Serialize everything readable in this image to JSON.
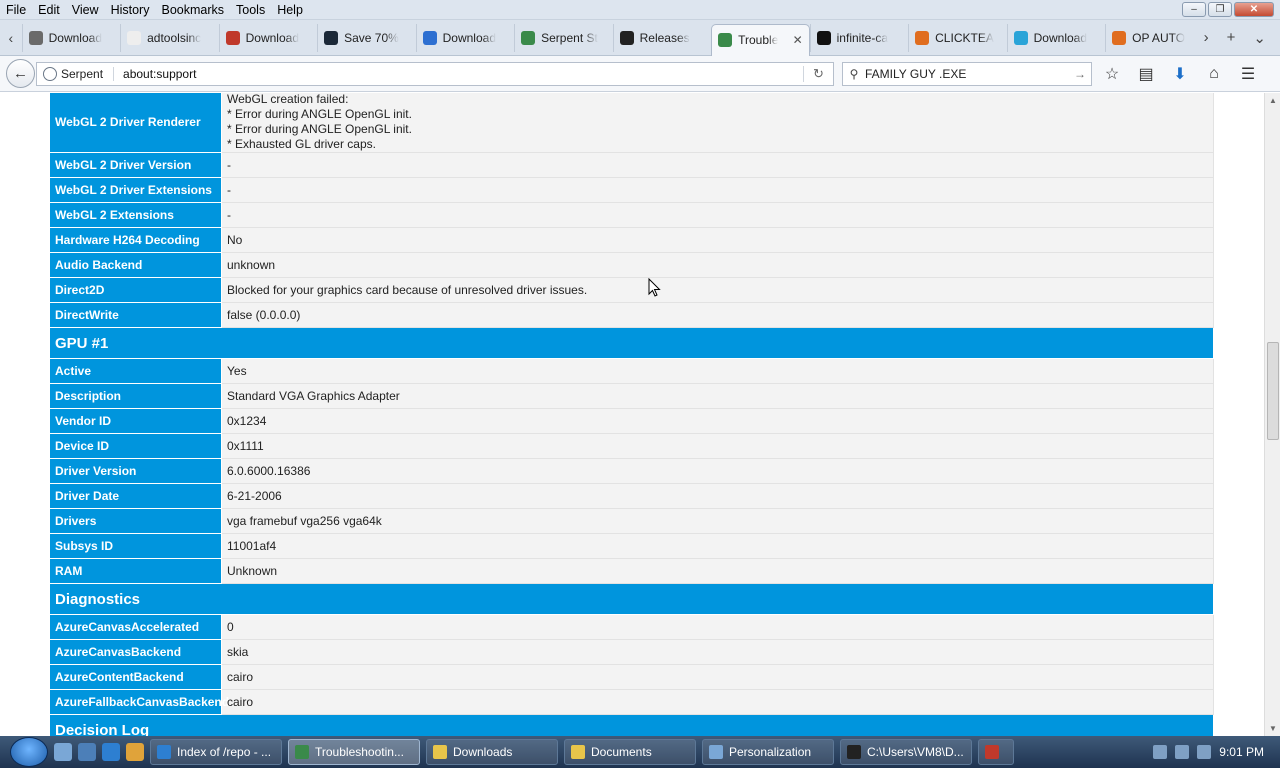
{
  "menu": [
    "File",
    "Edit",
    "View",
    "History",
    "Bookmarks",
    "Tools",
    "Help"
  ],
  "tabs": [
    {
      "label": "Download",
      "color": "#6a6a6a"
    },
    {
      "label": "adtoolsinc",
      "color": "#eeeeee"
    },
    {
      "label": "Download",
      "color": "#c0392b"
    },
    {
      "label": "Save 70%",
      "color": "#1b2838"
    },
    {
      "label": "Download",
      "color": "#2d6fd1"
    },
    {
      "label": "Serpent St",
      "color": "#3a8a4a"
    },
    {
      "label": "Releases",
      "color": "#222222"
    },
    {
      "label": "Trouble",
      "color": "#3a8a4a",
      "active": true
    },
    {
      "label": "infinite-ca",
      "color": "#111111"
    },
    {
      "label": "CLICKTEA",
      "color": "#e06d1f"
    },
    {
      "label": "Download",
      "color": "#2aa4d8"
    },
    {
      "label": "OP AUTO",
      "color": "#e06d1f"
    }
  ],
  "nav": {
    "brand": "Serpent",
    "url": "about:support",
    "search": "FAMILY GUY .EXE"
  },
  "rows": [
    {
      "type": "row",
      "key": "WebGL 2 Driver Renderer",
      "lines": [
        "WebGL creation failed:",
        "* Error during ANGLE OpenGL init.",
        "* Error during ANGLE OpenGL init.",
        "* Exhausted GL driver caps."
      ]
    },
    {
      "type": "row",
      "key": "WebGL 2 Driver Version",
      "value": "-"
    },
    {
      "type": "row",
      "key": "WebGL 2 Driver Extensions",
      "value": "-"
    },
    {
      "type": "row",
      "key": "WebGL 2 Extensions",
      "value": "-"
    },
    {
      "type": "row",
      "key": "Hardware H264 Decoding",
      "value": "No"
    },
    {
      "type": "row",
      "key": "Audio Backend",
      "value": "unknown"
    },
    {
      "type": "row",
      "key": "Direct2D",
      "value": "Blocked for your graphics card because of unresolved driver issues."
    },
    {
      "type": "row",
      "key": "DirectWrite",
      "value": "false (0.0.0.0)"
    },
    {
      "type": "section",
      "title": "GPU #1"
    },
    {
      "type": "row",
      "key": "Active",
      "value": "Yes"
    },
    {
      "type": "row",
      "key": "Description",
      "value": "Standard VGA Graphics Adapter"
    },
    {
      "type": "row",
      "key": "Vendor ID",
      "value": "0x1234"
    },
    {
      "type": "row",
      "key": "Device ID",
      "value": "0x1111"
    },
    {
      "type": "row",
      "key": "Driver Version",
      "value": "6.0.6000.16386"
    },
    {
      "type": "row",
      "key": "Driver Date",
      "value": "6-21-2006"
    },
    {
      "type": "row",
      "key": "Drivers",
      "value": "vga framebuf vga256 vga64k"
    },
    {
      "type": "row",
      "key": "Subsys ID",
      "value": "11001af4"
    },
    {
      "type": "row",
      "key": "RAM",
      "value": "Unknown"
    },
    {
      "type": "section",
      "title": "Diagnostics"
    },
    {
      "type": "row",
      "key": "AzureCanvasAccelerated",
      "value": "0"
    },
    {
      "type": "row",
      "key": "AzureCanvasBackend",
      "value": "skia"
    },
    {
      "type": "row",
      "key": "AzureContentBackend",
      "value": "cairo"
    },
    {
      "type": "row",
      "key": "AzureFallbackCanvasBackend",
      "value": "cairo"
    },
    {
      "type": "section",
      "title": "Decision Log"
    }
  ],
  "taskbar": [
    {
      "label": "Index of /repo - ...",
      "color": "#2d7fd1"
    },
    {
      "label": "Troubleshootin...",
      "color": "#3a8a4a",
      "active": true
    },
    {
      "label": "Downloads",
      "color": "#e8c54a"
    },
    {
      "label": "Documents",
      "color": "#e8c54a"
    },
    {
      "label": "Personalization",
      "color": "#7aa7d6"
    },
    {
      "label": "C:\\Users\\VM8\\D...",
      "color": "#222222"
    },
    {
      "label": "",
      "color": "#c0392b"
    }
  ],
  "clock": "9:01 PM"
}
